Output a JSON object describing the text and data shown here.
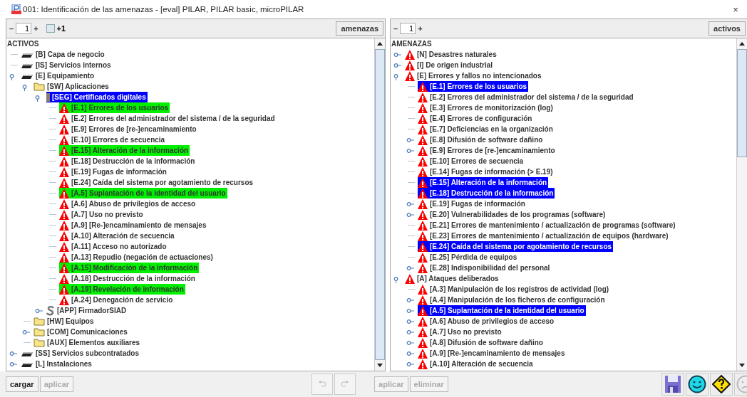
{
  "window": {
    "title": "001: Identificación de las amenazas - [eval] PILAR, PILAR basic, microPILAR",
    "close": "×"
  },
  "assets_panel": {
    "toolbar": {
      "minus": "–",
      "level": "1",
      "plus": "+",
      "checkbox": {
        "label": "+1",
        "checked": false
      },
      "button": "amenazas"
    },
    "heading": "ACTIVOS",
    "tree": [
      {
        "label": "[B] Capa de negocio",
        "kind": "layer",
        "selected": false
      },
      {
        "label": "[IS] Servicios internos",
        "kind": "layer",
        "selected": false
      },
      {
        "label": "[E] Equipamiento",
        "kind": "layer",
        "expanded": true,
        "selected": false,
        "children": [
          {
            "label": "[SW] Aplicaciones",
            "kind": "folder",
            "expanded": true,
            "selected": false,
            "children": [
              {
                "label": "[SEG] Certificados digitales",
                "kind": "certificate",
                "expanded": true,
                "selected": true,
                "children": [
                  {
                    "label": "[E.1] Errores de los usuarios",
                    "kind": "threat",
                    "selected": false,
                    "marked": true
                  },
                  {
                    "label": "[E.2] Errores del administrador del sistema / de la seguridad",
                    "kind": "threat",
                    "selected": false,
                    "marked": false
                  },
                  {
                    "label": "[E.9] Errores de [re-]encaminamiento",
                    "kind": "threat",
                    "selected": false,
                    "marked": false
                  },
                  {
                    "label": "[E.10] Errores de secuencia",
                    "kind": "threat",
                    "selected": false,
                    "marked": false
                  },
                  {
                    "label": "[E.15] Alteración de la información",
                    "kind": "threat",
                    "selected": false,
                    "marked": true
                  },
                  {
                    "label": "[E.18] Destrucción de la información",
                    "kind": "threat",
                    "selected": false,
                    "marked": false
                  },
                  {
                    "label": "[E.19] Fugas de información",
                    "kind": "threat",
                    "selected": false,
                    "marked": false
                  },
                  {
                    "label": "[E.24] Caída del sistema por agotamiento de recursos",
                    "kind": "threat",
                    "selected": false,
                    "marked": false
                  },
                  {
                    "label": "[A.5] Suplantación de la identidad del usuario",
                    "kind": "threat",
                    "selected": false,
                    "marked": true
                  },
                  {
                    "label": "[A.6] Abuso de privilegios de acceso",
                    "kind": "threat",
                    "selected": false,
                    "marked": false
                  },
                  {
                    "label": "[A.7] Uso no previsto",
                    "kind": "threat",
                    "selected": false,
                    "marked": false
                  },
                  {
                    "label": "[A.9] [Re-]encaminamiento de mensajes",
                    "kind": "threat",
                    "selected": false,
                    "marked": false
                  },
                  {
                    "label": "[A.10] Alteración de secuencia",
                    "kind": "threat",
                    "selected": false,
                    "marked": false
                  },
                  {
                    "label": "[A.11] Acceso no autorizado",
                    "kind": "threat",
                    "selected": false,
                    "marked": false
                  },
                  {
                    "label": "[A.13] Repudio (negación de actuaciones)",
                    "kind": "threat",
                    "selected": false,
                    "marked": false
                  },
                  {
                    "label": "[A.15] Modificación de la información",
                    "kind": "threat",
                    "selected": false,
                    "marked": true
                  },
                  {
                    "label": "[A.18] Destrucción de la información",
                    "kind": "threat",
                    "selected": false,
                    "marked": false
                  },
                  {
                    "label": "[A.19] Revelación de información",
                    "kind": "threat",
                    "selected": false,
                    "marked": true
                  },
                  {
                    "label": "[A.24] Denegación de servicio",
                    "kind": "threat",
                    "selected": false,
                    "marked": false
                  }
                ]
              },
              {
                "label": "[APP] FirmadorSIAD",
                "kind": "software",
                "expanded": false,
                "selected": false
              }
            ]
          },
          {
            "label": "[HW] Equipos",
            "kind": "folder",
            "selected": false
          },
          {
            "label": "[COM] Comunicaciones",
            "kind": "folder",
            "expanded": false,
            "selected": false
          },
          {
            "label": "[AUX] Elementos auxiliares",
            "kind": "folder",
            "selected": false
          }
        ]
      },
      {
        "label": "[SS] Servicios subcontratados",
        "kind": "layer",
        "expanded": false,
        "selected": false
      },
      {
        "label": "[L] Instalaciones",
        "kind": "layer",
        "expanded": false,
        "selected": false
      }
    ],
    "buttons": [
      {
        "label": "cargar",
        "disabled": false
      },
      {
        "label": "aplicar",
        "disabled": true
      }
    ]
  },
  "threats_panel": {
    "toolbar": {
      "minus": "–",
      "level": "1",
      "plus": "+",
      "button": "activos"
    },
    "heading": "AMENAZAS",
    "tree": [
      {
        "label": "[N] Desastres naturales",
        "kind": "threat",
        "expanded": false,
        "selected": false
      },
      {
        "label": "[I] De origen industrial",
        "kind": "threat",
        "expanded": false,
        "selected": false
      },
      {
        "label": "[E] Errores y fallos no intencionados",
        "kind": "threat",
        "expanded": true,
        "selected": false,
        "children": [
          {
            "label": "[E.1] Errores de los usuarios",
            "kind": "threat",
            "selected": true
          },
          {
            "label": "[E.2] Errores del administrador del sistema / de la seguridad",
            "kind": "threat",
            "selected": false
          },
          {
            "label": "[E.3] Errores de monitorización (log)",
            "kind": "threat",
            "selected": false
          },
          {
            "label": "[E.4] Errores de configuración",
            "kind": "threat",
            "selected": false
          },
          {
            "label": "[E.7] Deficiencias en la organización",
            "kind": "threat",
            "selected": false
          },
          {
            "label": "[E.8] Difusión de software dañino",
            "kind": "threat",
            "expanded": false,
            "selected": false
          },
          {
            "label": "[E.9] Errores de [re-]encaminamiento",
            "kind": "threat",
            "expanded": false,
            "selected": false
          },
          {
            "label": "[E.10] Errores de secuencia",
            "kind": "threat",
            "selected": false
          },
          {
            "label": "[E.14] Fugas de información (> E.19)",
            "kind": "threat",
            "selected": false
          },
          {
            "label": "[E.15] Alteración de la información",
            "kind": "threat",
            "selected": true
          },
          {
            "label": "[E.18] Destrucción de la información",
            "kind": "threat",
            "selected": true
          },
          {
            "label": "[E.19] Fugas de información",
            "kind": "threat",
            "expanded": false,
            "selected": false
          },
          {
            "label": "[E.20] Vulnerabilidades de los programas (software)",
            "kind": "threat",
            "expanded": false,
            "selected": false
          },
          {
            "label": "[E.21] Errores de mantenimiento / actualización de programas (software)",
            "kind": "threat",
            "selected": false
          },
          {
            "label": "[E.23] Errores de mantenimiento / actualización de equipos (hardware)",
            "kind": "threat",
            "selected": false
          },
          {
            "label": "[E.24] Caída del sistema por agotamiento de recursos",
            "kind": "threat",
            "selected": true
          },
          {
            "label": "[E.25] Pérdida de equipos",
            "kind": "threat",
            "selected": false
          },
          {
            "label": "[E.28] Indisponibilidad del personal",
            "kind": "threat",
            "expanded": false,
            "selected": false
          }
        ]
      },
      {
        "label": "[A] Ataques deliberados",
        "kind": "threat",
        "expanded": true,
        "selected": false,
        "children": [
          {
            "label": "[A.3] Manipulación de los registros de actividad (log)",
            "kind": "threat",
            "selected": false
          },
          {
            "label": "[A.4] Manipulación de los ficheros de configuración",
            "kind": "threat",
            "expanded": false,
            "selected": false
          },
          {
            "label": "[A.5] Suplantación de la identidad del usuario",
            "kind": "threat",
            "expanded": false,
            "selected": true
          },
          {
            "label": "[A.6] Abuso de privilegios de acceso",
            "kind": "threat",
            "expanded": false,
            "selected": false
          },
          {
            "label": "[A.7] Uso no previsto",
            "kind": "threat",
            "expanded": false,
            "selected": false
          },
          {
            "label": "[A.8] Difusión de software dañino",
            "kind": "threat",
            "expanded": false,
            "selected": false
          },
          {
            "label": "[A.9] [Re-]encaminamiento de mensajes",
            "kind": "threat",
            "expanded": false,
            "selected": false
          },
          {
            "label": "[A.10] Alteración de secuencia",
            "kind": "threat",
            "expanded": false,
            "selected": false
          }
        ]
      }
    ],
    "history": [
      {
        "kind": "undo",
        "disabled": true
      },
      {
        "kind": "redo",
        "disabled": true
      }
    ],
    "buttons": [
      {
        "label": "aplicar",
        "disabled": true
      },
      {
        "label": "eliminar",
        "disabled": true
      }
    ]
  }
}
